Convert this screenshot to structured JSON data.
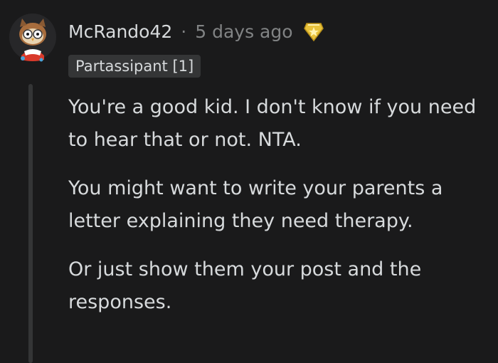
{
  "comment": {
    "username": "McRando42",
    "separator": "·",
    "timestamp": "5 days ago",
    "award_icon": "golden-award-icon",
    "flair": "Partassipant [1]",
    "paragraphs": [
      "You're a good kid. I don't know if you need to hear that or not. NTA.",
      "You might want to write your parents a letter explaining they need therapy.",
      "Or just show them your post and the responses."
    ]
  },
  "colors": {
    "background": "#1a1a1b",
    "text": "#d7dadc",
    "muted": "#818384",
    "flair_bg": "#343536",
    "thread_line": "#343536",
    "award_gold": "#e8c23b"
  }
}
